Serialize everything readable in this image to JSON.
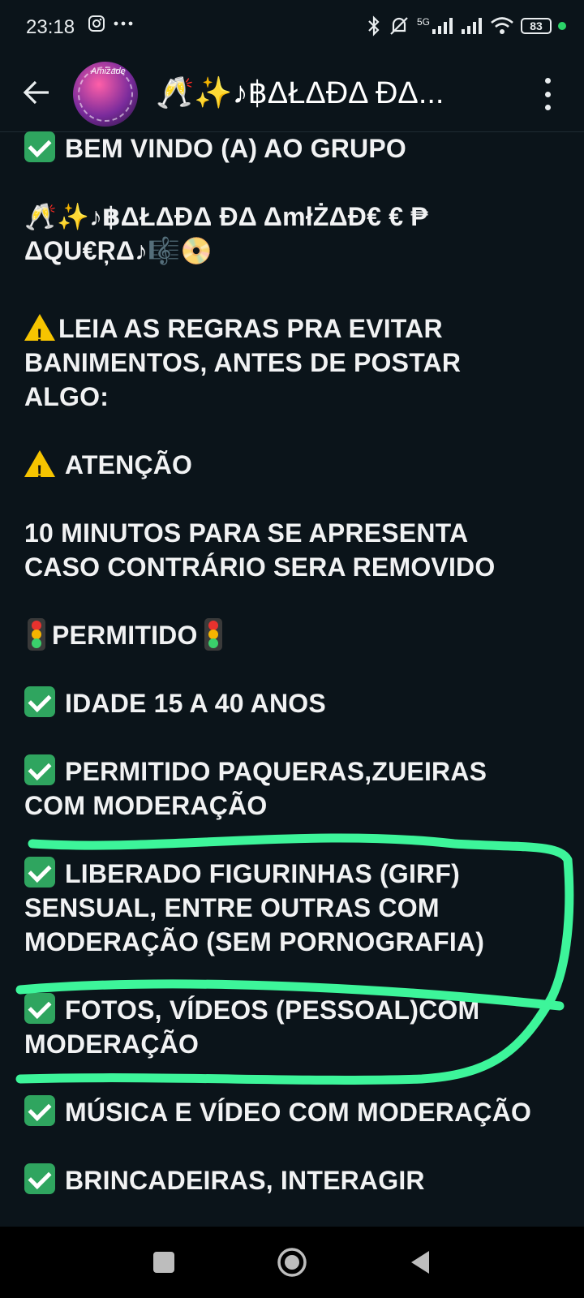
{
  "status_bar": {
    "time": "23:18",
    "battery": "83",
    "network": "5G"
  },
  "header": {
    "title": "🥂✨♪฿ΔŁΔĐΔ ĐΔ...",
    "avatar_label": "Amizade"
  },
  "message": {
    "lines": [
      "BEM VINDO (A) AO GRUPO",
      "🥂✨♪฿ΔŁΔĐΔ ĐΔ ΔmłŻΔĐ€ € ₱",
      "ΔQU€ŖΔ♪🎼📀",
      "LEIA AS REGRAS PRA EVITAR",
      "BANIMENTOS, ANTES DE POSTAR",
      "ALGO:",
      "ATENÇÃO",
      "10 MINUTOS PARA SE APRESENTA",
      "CASO CONTRÁRIO SERA REMOVIDO",
      "PERMITIDO",
      "IDADE 15 A 40 ANOS",
      "PERMITIDO PAQUERAS,ZUEIRAS",
      "COM MODERAÇÃO",
      "LIBERADO FIGURINHAS (GIRF)",
      "SENSUAL, ENTRE OUTRAS COM",
      "MODERAÇÃO (SEM PORNOGRAFIA)",
      "FOTOS, VÍDEOS (PESSOAL)COM",
      "MODERAÇÃO",
      "MÚSICA E VÍDEO COM MODERAÇÃO",
      "BRINCADEIRAS, INTERAGIR"
    ]
  },
  "annotation": {
    "color": "#3df59a"
  },
  "nav": {
    "icons": [
      "recents-square-icon",
      "home-circle-icon",
      "back-triangle-icon"
    ]
  }
}
